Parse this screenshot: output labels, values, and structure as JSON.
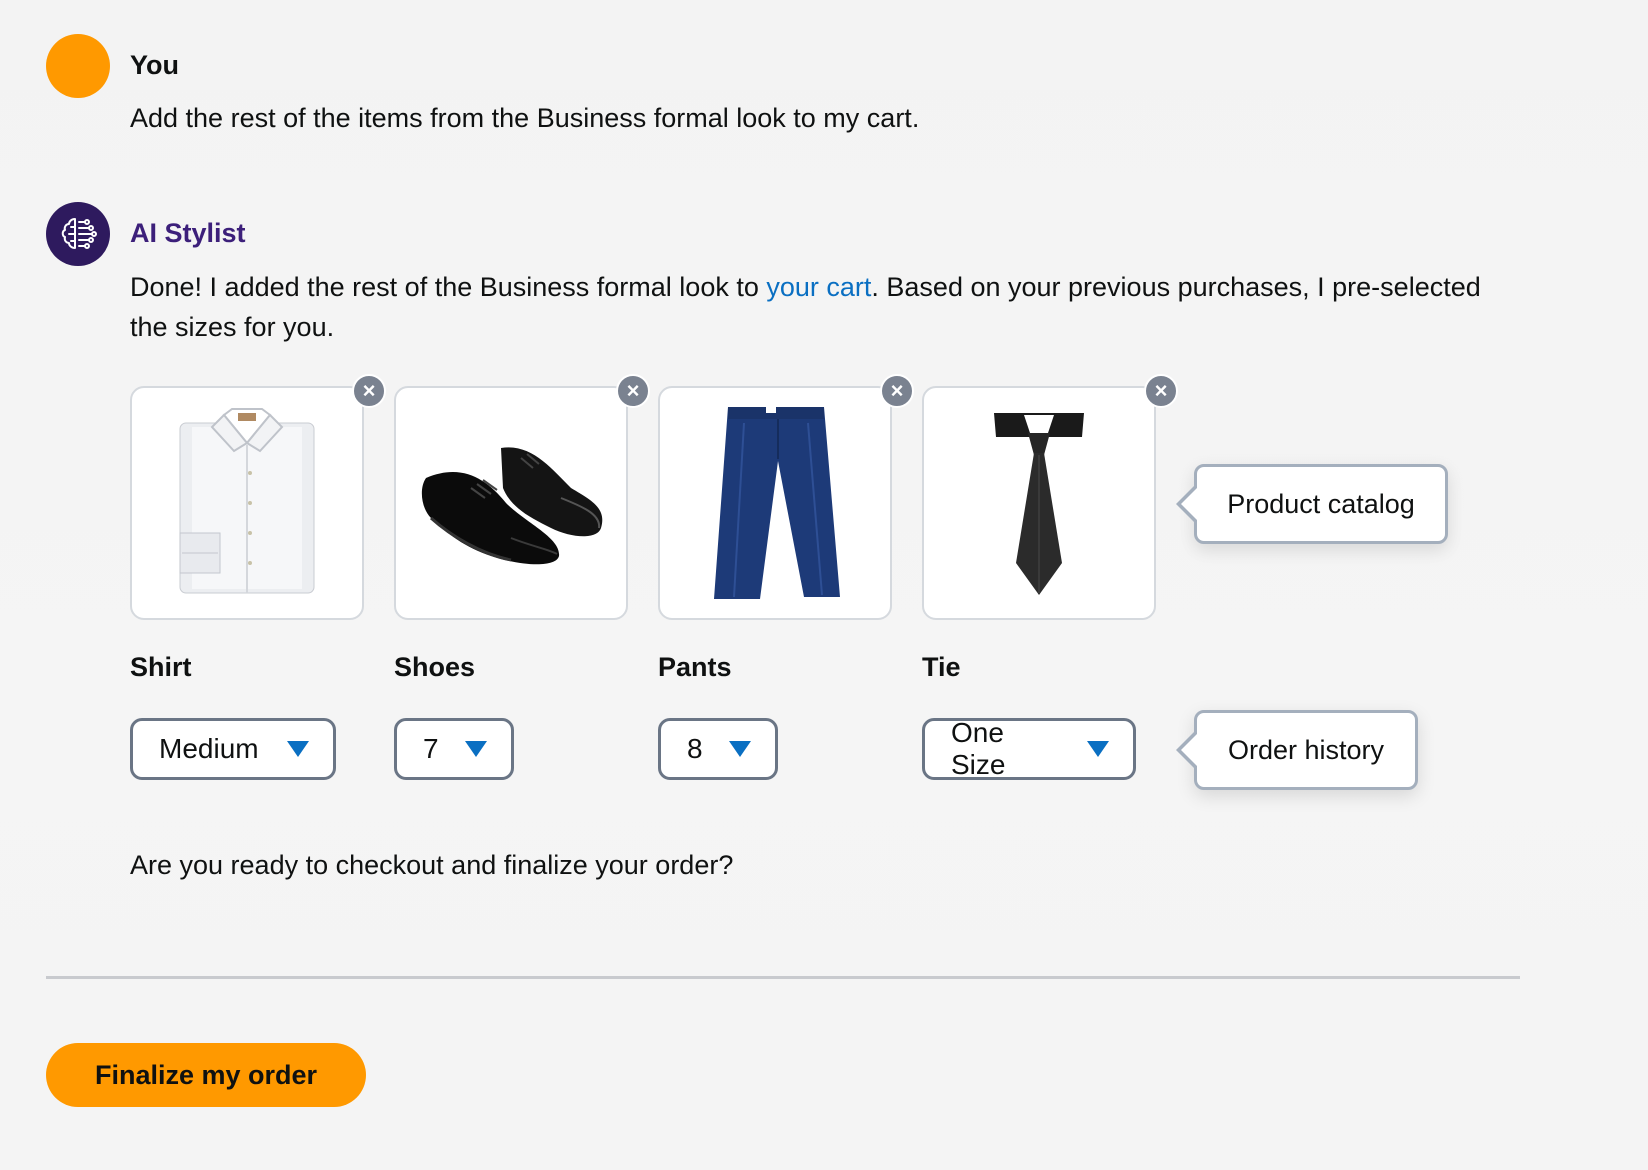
{
  "user_message": {
    "sender": "You",
    "text": "Add the rest of the items from the Business formal look to my cart."
  },
  "ai_message": {
    "sender": "AI Stylist",
    "text_before_link": "Done! I added the rest of the Business formal look to ",
    "link_text": "your cart",
    "text_after_link": ". Based on your previous purchases, I pre-selected the sizes for you."
  },
  "products": [
    {
      "name": "Shirt",
      "size": "Medium",
      "icon": "shirt-image"
    },
    {
      "name": "Shoes",
      "size": "7",
      "icon": "shoes-image"
    },
    {
      "name": "Pants",
      "size": "8",
      "icon": "pants-image"
    },
    {
      "name": "Tie",
      "size": "One Size",
      "icon": "tie-image"
    }
  ],
  "callouts": {
    "catalog": "Product catalog",
    "history": "Order history"
  },
  "question": "Are you ready to checkout and finalize your order?",
  "finalize_button": "Finalize my order",
  "colors": {
    "user_avatar": "#ff9900",
    "ai_avatar": "#2e1a5e",
    "ai_name": "#3c1f7a",
    "link": "#0a6fc2",
    "primary_button": "#ff9900"
  }
}
